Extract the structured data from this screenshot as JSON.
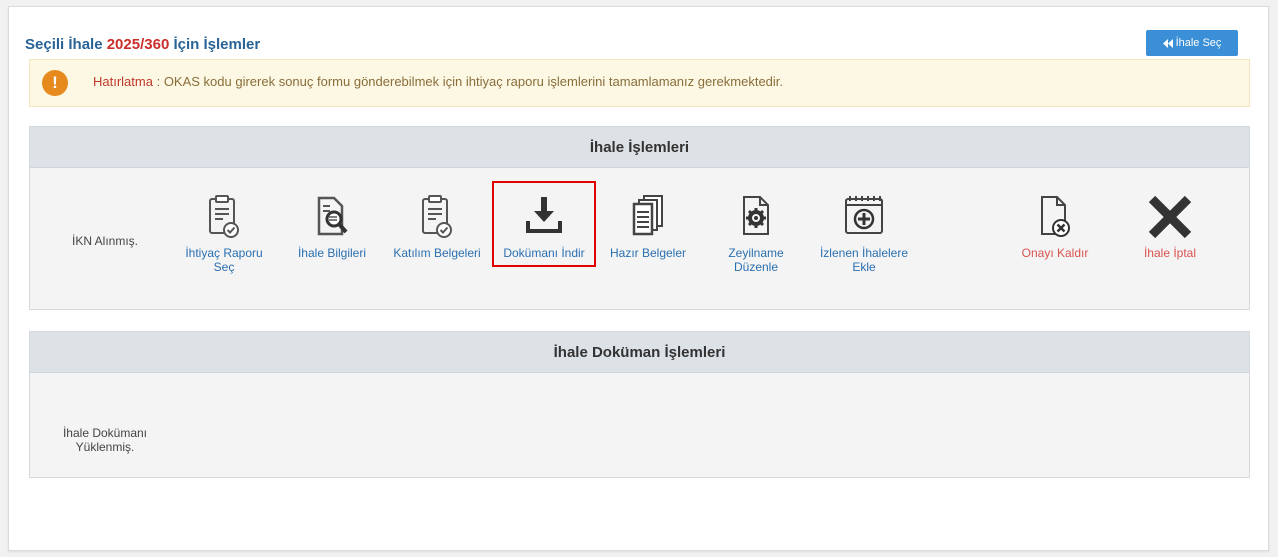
{
  "header": {
    "prefix": "Seçili İhale",
    "ikn": "2025/360",
    "suffix": "İçin İşlemler"
  },
  "back_button": {
    "label": "İhale Seç",
    "icon": "double-chevron-left-icon"
  },
  "alert": {
    "icon": "exclamation-icon",
    "label": "Hatırlatma",
    "message": ": OKAS kodu girerek sonuç formu gönderebilmek için ihtiyaç raporu işlemlerini tamamlamanız gerekmektedir."
  },
  "panel_actions": {
    "title": "İhale İşlemleri",
    "status_text": "İKN Alınmış.",
    "items": [
      {
        "line1": "İhtiyaç Raporu",
        "line2": "Seç",
        "icon": "clipboard-check-icon"
      },
      {
        "line1": "İhale Bilgileri",
        "line2": "",
        "icon": "document-search-icon"
      },
      {
        "line1": "Katılım Belgeleri",
        "line2": "",
        "icon": "clipboard-check-icon"
      },
      {
        "line1": "Dokümanı İndir",
        "line2": "",
        "icon": "download-icon"
      },
      {
        "line1": "Hazır Belgeler",
        "line2": "",
        "icon": "documents-stack-icon"
      },
      {
        "line1": "Zeyilname",
        "line2": "Düzenle",
        "icon": "document-gear-icon"
      },
      {
        "line1": "İzlenen İhalelere",
        "line2": "Ekle",
        "icon": "calendar-plus-icon"
      },
      {
        "line1": "Onayı Kaldır",
        "line2": "",
        "icon": "document-remove-icon"
      },
      {
        "line1": "İhale İptal",
        "line2": "",
        "icon": "close-icon"
      }
    ]
  },
  "panel_documents": {
    "title": "İhale Doküman İşlemleri",
    "status_line1": "İhale Dokümanı",
    "status_line2": "Yüklenmiş."
  },
  "colors": {
    "link": "#2a6fb0",
    "danger": "#d9534f",
    "accent_button": "#3a8fd6",
    "alert_bg": "#fcf8e3"
  }
}
